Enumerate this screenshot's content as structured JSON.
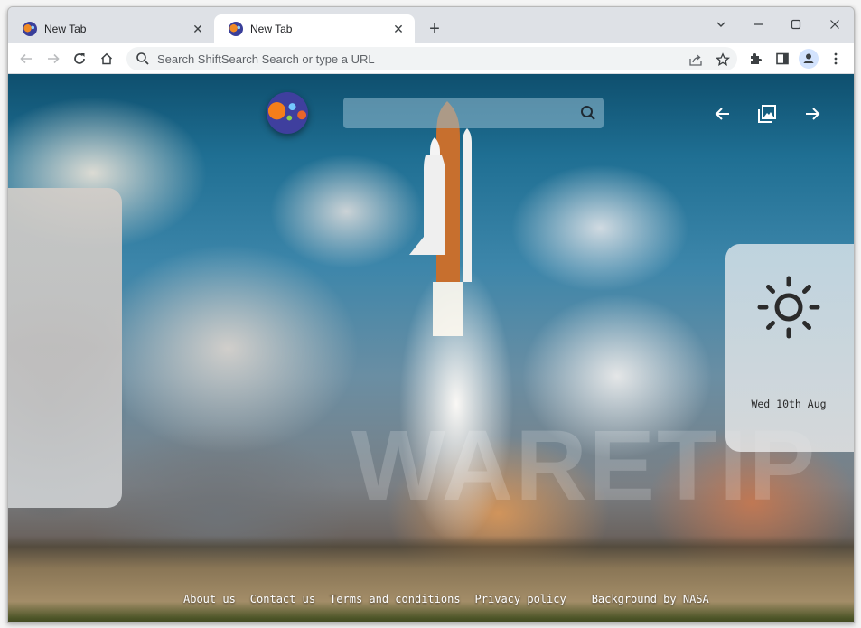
{
  "browser": {
    "tabs": [
      {
        "title": "New Tab",
        "active": false
      },
      {
        "title": "New Tab",
        "active": true
      }
    ],
    "new_tab_label": "+",
    "omnibox": {
      "value": "",
      "placeholder": "Search ShiftSearch Search or type a URL"
    },
    "icons": {
      "back": "arrow-left-icon",
      "forward": "arrow-right-icon",
      "reload": "reload-icon",
      "home": "home-icon",
      "share": "share-icon",
      "bookmark": "star-icon",
      "extensions": "puzzle-icon",
      "side_panel": "side-panel-icon",
      "profile": "profile-icon",
      "menu": "kebab-menu-icon"
    }
  },
  "page": {
    "search": {
      "value": "",
      "placeholder": ""
    },
    "watermark": "WAREТIP",
    "background_nav": {
      "prev": "arrow-left-icon",
      "gallery": "gallery-icon",
      "next": "arrow-right-icon"
    },
    "weather": {
      "icon": "sun-icon",
      "date": "Wed 10th Aug"
    },
    "footer": {
      "links": [
        "About us",
        "Contact us",
        "Terms and conditions",
        "Privacy policy"
      ],
      "credit": "Background by NASA"
    },
    "colors": {
      "sky_top": "#0e4f6e",
      "sky_mid": "#3d86aa",
      "search_bg": "#96bed2",
      "logo_bg": "#3f3f9e"
    }
  }
}
